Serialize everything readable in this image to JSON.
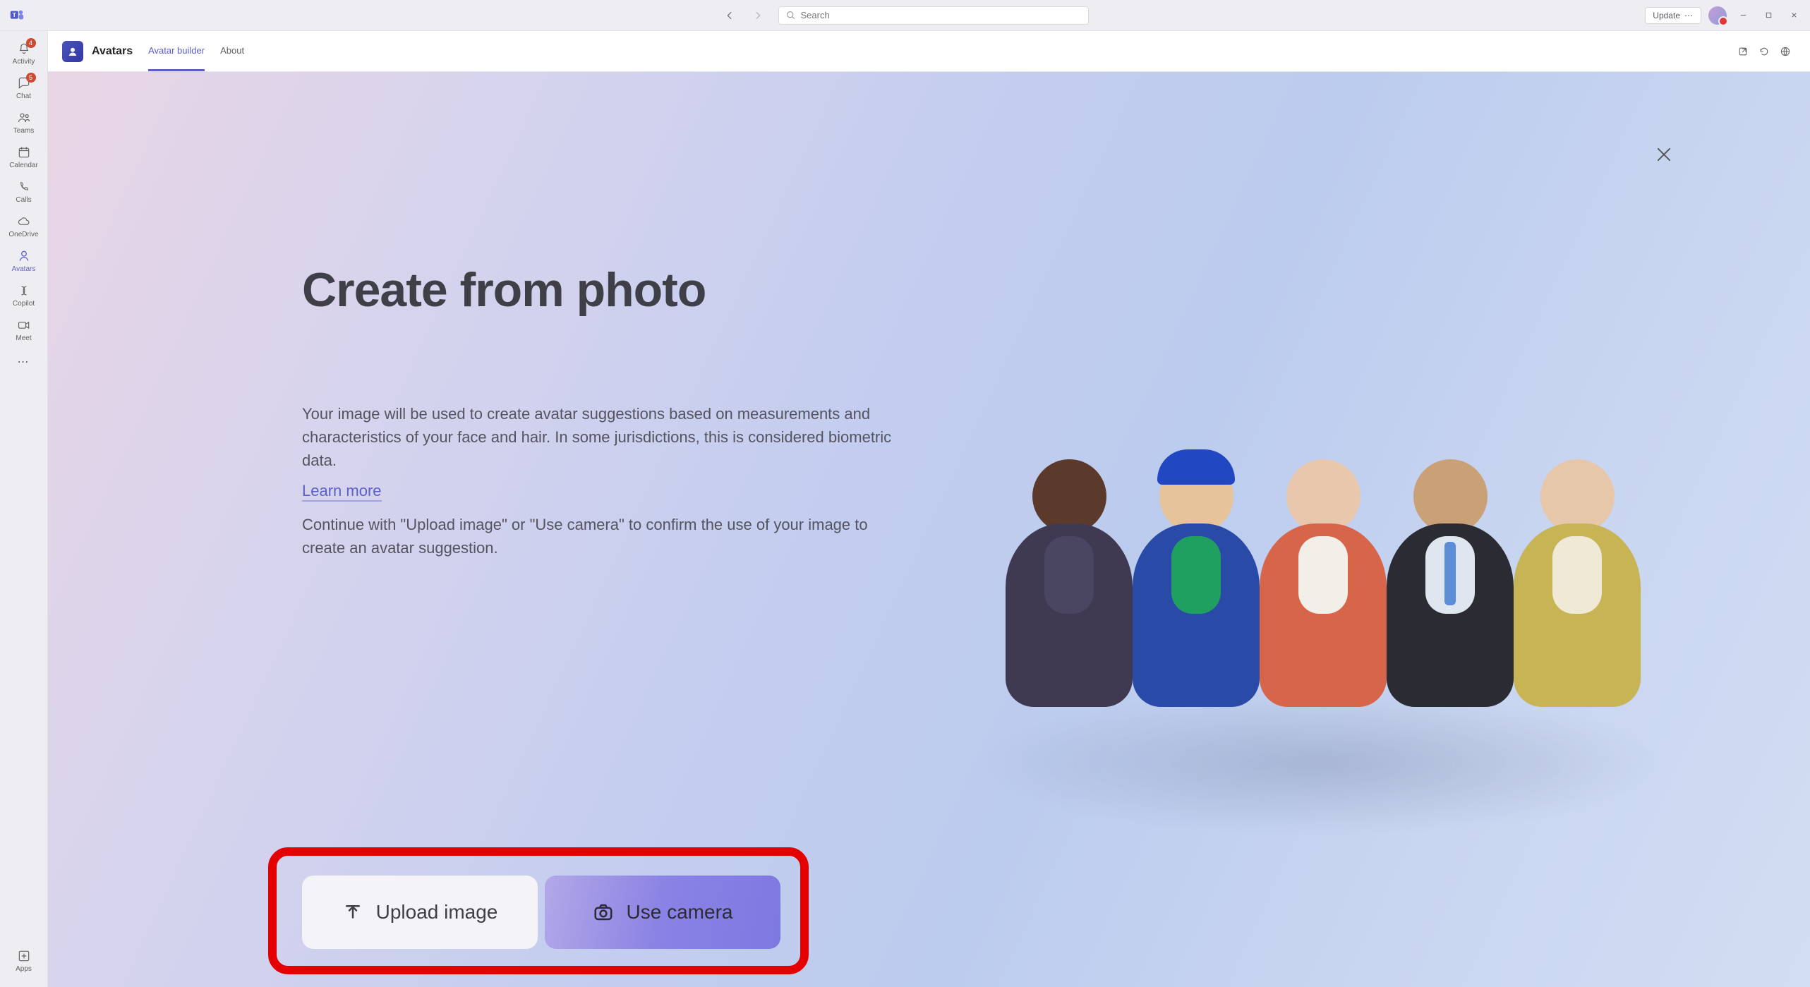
{
  "titlebar": {
    "search_placeholder": "Search",
    "update_label": "Update"
  },
  "rail": {
    "items": [
      {
        "key": "activity",
        "label": "Activity",
        "badge": "4"
      },
      {
        "key": "chat",
        "label": "Chat",
        "badge": "5"
      },
      {
        "key": "teams",
        "label": "Teams"
      },
      {
        "key": "calendar",
        "label": "Calendar"
      },
      {
        "key": "calls",
        "label": "Calls"
      },
      {
        "key": "onedrive",
        "label": "OneDrive"
      },
      {
        "key": "avatars",
        "label": "Avatars",
        "active": true
      },
      {
        "key": "copilot",
        "label": "Copilot"
      },
      {
        "key": "meet",
        "label": "Meet"
      }
    ],
    "apps_label": "Apps"
  },
  "appbar": {
    "app_name": "Avatars",
    "tabs": [
      {
        "key": "builder",
        "label": "Avatar builder",
        "active": true
      },
      {
        "key": "about",
        "label": "About"
      }
    ]
  },
  "page": {
    "title": "Create from photo",
    "body1": "Your image will be used to create avatar suggestions based on measurements and characteristics of your face and hair. In some jurisdictions, this is considered biometric data.",
    "learn_more": "Learn more",
    "body2": "Continue with \"Upload image\" or \"Use camera\" to confirm the use of your image to create an avatar suggestion.",
    "upload_label": "Upload image",
    "camera_label": "Use camera"
  },
  "avatar_figures": [
    {
      "head": "#5b3a2c",
      "body": "#3f3a52",
      "shirt": "#4a4560"
    },
    {
      "head": "#e6c39b",
      "body": "#2a4aa8",
      "shirt": "#20a060",
      "cap": "#2147c2"
    },
    {
      "head": "#e9c7ad",
      "body": "#d7654a",
      "shirt": "#f2efe8"
    },
    {
      "head": "#caa076",
      "body": "#2b2b33",
      "shirt": "#dfe6ef",
      "tie": "#5b8ed6"
    },
    {
      "head": "#e7c7a9",
      "body": "#c6b455",
      "shirt": "#efe9d6"
    }
  ],
  "colors": {
    "accent": "#5b5fc7",
    "highlight_border": "#e40000"
  }
}
